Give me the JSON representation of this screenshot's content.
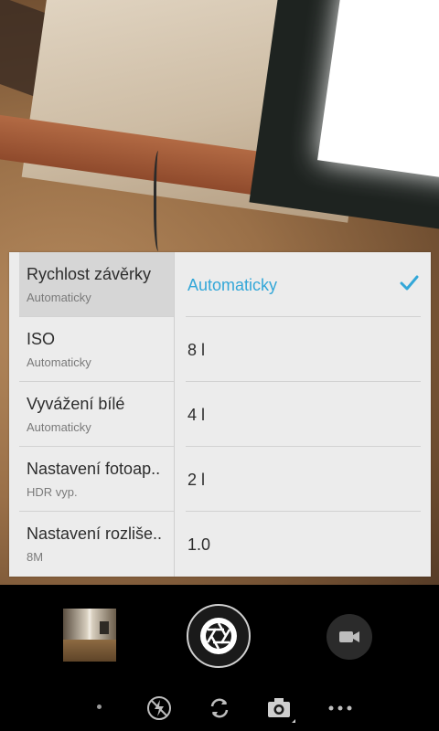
{
  "settings_menu": {
    "categories": [
      {
        "title": "Rychlost závěrky",
        "value": "Automaticky",
        "selected": true
      },
      {
        "title": "ISO",
        "value": "Automaticky",
        "selected": false
      },
      {
        "title": "Vyvážení bílé",
        "value": "Automaticky",
        "selected": false
      },
      {
        "title": "Nastavení fotoap..",
        "value": "HDR vyp.",
        "selected": false
      },
      {
        "title": "Nastavení rozliše..",
        "value": "8M",
        "selected": false
      }
    ],
    "options": [
      {
        "label": "Automaticky",
        "selected": true
      },
      {
        "label": "8 l",
        "selected": false
      },
      {
        "label": "4 l",
        "selected": false
      },
      {
        "label": "2 l",
        "selected": false
      },
      {
        "label": "1.0",
        "selected": false
      }
    ]
  },
  "controls": {
    "gallery_thumbnail": "thumbnail-icon",
    "shutter": "shutter-icon",
    "video": "video-camera-icon",
    "flash": "flash-off-icon",
    "switch_camera": "switch-camera-icon",
    "mode": "camera-mode-icon",
    "more": "more-icon"
  },
  "colors": {
    "accent": "#33a7d8"
  }
}
